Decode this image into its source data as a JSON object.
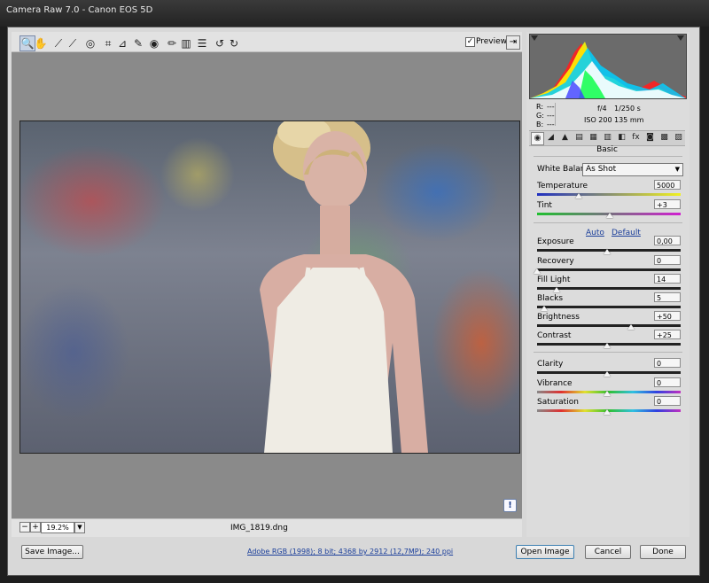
{
  "window": {
    "title": "Camera Raw 7.0  -  Canon EOS 5D"
  },
  "toolbar": {
    "tools": [
      {
        "name": "zoom-tool-icon",
        "glyph": "🔍"
      },
      {
        "name": "hand-tool-icon",
        "glyph": "✋"
      },
      {
        "name": "white-balance-tool-icon",
        "glyph": "⟋"
      },
      {
        "name": "color-sampler-tool-icon",
        "glyph": "⟋"
      },
      {
        "name": "targeted-adjustment-tool-icon",
        "glyph": "◎"
      },
      {
        "name": "crop-tool-icon",
        "glyph": "⌗"
      },
      {
        "name": "straighten-tool-icon",
        "glyph": "⊿"
      },
      {
        "name": "spot-removal-tool-icon",
        "glyph": "✎"
      },
      {
        "name": "red-eye-tool-icon",
        "glyph": "◉"
      },
      {
        "name": "adjustment-brush-icon",
        "glyph": "✏"
      },
      {
        "name": "graduated-filter-icon",
        "glyph": "▥"
      },
      {
        "name": "preferences-icon",
        "glyph": "☰"
      },
      {
        "name": "rotate-ccw-icon",
        "glyph": "↺"
      },
      {
        "name": "rotate-cw-icon",
        "glyph": "↻"
      }
    ],
    "preview_label": "Preview",
    "preview_checked": "✓"
  },
  "status": {
    "zoom_minus": "−",
    "zoom_plus": "+",
    "zoom_value": "19.2%",
    "zoom_arrow": "▼",
    "filename": "IMG_1819.dng",
    "warning": "!"
  },
  "readouts": {
    "r_label": "R:",
    "g_label": "G:",
    "b_label": "B:",
    "r_value": "---",
    "g_value": "---",
    "b_value": "---",
    "aperture": "f/4",
    "shutter": "1/250 s",
    "iso": "ISO 200",
    "focal": "135 mm"
  },
  "panel": {
    "section_title": "Basic",
    "tabs": [
      "◉",
      "◢",
      "▲",
      "▤",
      "▦",
      "▥",
      "◧",
      "fx",
      "◙",
      "▩",
      "▨"
    ],
    "white_balance_label": "White Balance:",
    "white_balance_value": "As Shot",
    "auto_label": "Auto",
    "default_label": "Default",
    "sliders": [
      {
        "label": "Temperature",
        "value": "5000",
        "pos": 0.3,
        "track": "temp"
      },
      {
        "label": "Tint",
        "value": "+3",
        "pos": 0.52,
        "track": "tint"
      },
      {
        "label": "Exposure",
        "value": "0,00",
        "pos": 0.5,
        "track": "plain"
      },
      {
        "label": "Recovery",
        "value": "0",
        "pos": 0.0,
        "track": "plain"
      },
      {
        "label": "Fill Light",
        "value": "14",
        "pos": 0.14,
        "track": "plain"
      },
      {
        "label": "Blacks",
        "value": "5",
        "pos": 0.05,
        "track": "plain"
      },
      {
        "label": "Brightness",
        "value": "+50",
        "pos": 0.67,
        "track": "plain"
      },
      {
        "label": "Contrast",
        "value": "+25",
        "pos": 0.5,
        "track": "plain"
      },
      {
        "label": "Clarity",
        "value": "0",
        "pos": 0.5,
        "track": "plain"
      },
      {
        "label": "Vibrance",
        "value": "0",
        "pos": 0.5,
        "track": "color"
      },
      {
        "label": "Saturation",
        "value": "0",
        "pos": 0.5,
        "track": "color"
      }
    ]
  },
  "bottom": {
    "save_label": "Save Image...",
    "info_link": "Adobe RGB (1998); 8 bit; 4368 by 2912 (12,7MP); 240 ppi",
    "open_label": "Open Image",
    "cancel_label": "Cancel",
    "done_label": "Done"
  }
}
